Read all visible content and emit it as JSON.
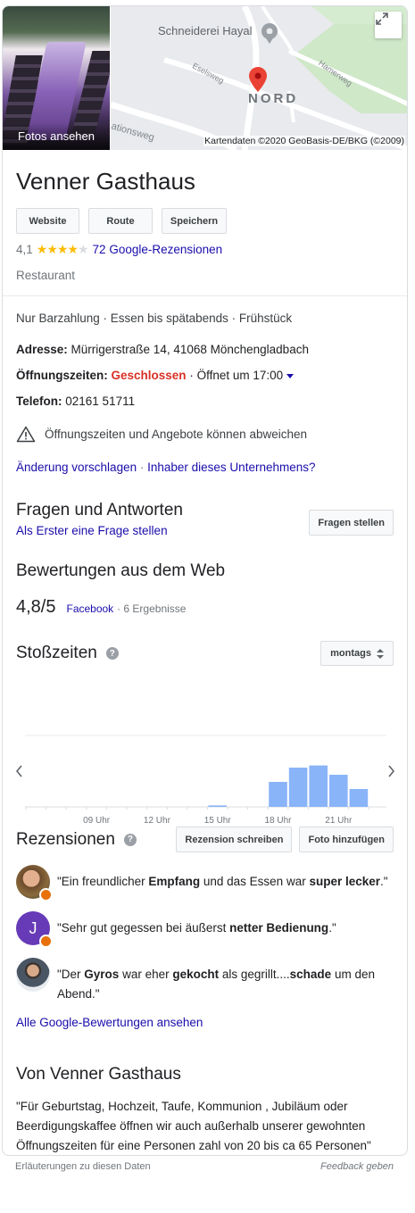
{
  "photo": {
    "label": "Fotos ansehen"
  },
  "map": {
    "place": "Schneiderei Hayal",
    "area": "NORD",
    "streets": [
      "Eselsweg",
      "Hamerweg",
      "ationsweg"
    ],
    "credit": "Kartendaten ©2020 GeoBasis-DE/BKG (©2009)"
  },
  "business": {
    "name": "Venner Gasthaus",
    "buttons": {
      "website": "Website",
      "route": "Route",
      "save": "Speichern"
    },
    "rating": "4,1",
    "stars_filled": 4,
    "reviews_link": "72 Google-Rezensionen",
    "category": "Restaurant"
  },
  "attributes": "Nur Barzahlung · Essen bis spätabends · Frühstück",
  "address": {
    "label": "Adresse:",
    "value": "Mürrigerstraße 14, 41068 Mönchengladbach"
  },
  "hours": {
    "label": "Öffnungszeiten:",
    "status": "Geschlossen",
    "next": "· Öffnet um 17:00"
  },
  "phone": {
    "label": "Telefon:",
    "value": "02161 51711"
  },
  "warning": "Öffnungszeiten und Angebote können abweichen",
  "links": {
    "suggest": "Änderung vorschlagen",
    "separator": "·",
    "owner": "Inhaber dieses Unternehmens?"
  },
  "qa": {
    "title": "Fragen und Antworten",
    "first": "Als Erster eine Frage stellen",
    "button": "Fragen stellen"
  },
  "web_reviews": {
    "title": "Bewertungen aus dem Web",
    "score": "4,8/5",
    "source": "Facebook",
    "count": "· 6 Ergebnisse"
  },
  "popular_times": {
    "title": "Stoßzeiten",
    "day": "montags",
    "chart_data": {
      "type": "bar",
      "x_ticks": [
        "09 Uhr",
        "12 Uhr",
        "15 Uhr",
        "18 Uhr",
        "21 Uhr"
      ],
      "hours": [
        6,
        7,
        8,
        9,
        10,
        11,
        12,
        13,
        14,
        15,
        16,
        17,
        18,
        19,
        20,
        21,
        22,
        23
      ],
      "values": [
        0,
        0,
        0,
        0,
        0,
        0,
        0,
        0,
        0,
        2,
        0,
        0,
        35,
        55,
        58,
        45,
        25,
        0
      ],
      "ylim": [
        0,
        100
      ],
      "color": "#8ab4f8"
    }
  },
  "reviews": {
    "title": "Rezensionen",
    "write": "Rezension schreiben",
    "photo": "Foto hinzufügen",
    "items": [
      {
        "initial": "",
        "parts": [
          "\"Ein freundlicher ",
          "Empfang",
          " und das Essen war ",
          "super lecker",
          ".\""
        ]
      },
      {
        "initial": "J",
        "parts": [
          "\"Sehr gut gegessen bei äußerst ",
          "netter Bedienung",
          ".\""
        ]
      },
      {
        "initial": "",
        "parts": [
          "\"Der ",
          "Gyros",
          " war eher ",
          "gekocht",
          " als gegrillt....",
          "schade",
          " um den Abend.\""
        ]
      }
    ],
    "all": "Alle Google-Bewertungen ansehen"
  },
  "from_business": {
    "title": "Von Venner Gasthaus",
    "text": "\"Für Geburtstag, Hochzeit, Taufe, Kommunion , Jubiläum oder Beerdigungskaffee öffnen wir auch außerhalb unserer gewohnten Öffnungszeiten für eine Personen zahl von 20 bis ca 65 Personen\""
  },
  "footer": {
    "left": "Erläuterungen zu diesen Daten",
    "right": "Feedback geben"
  }
}
